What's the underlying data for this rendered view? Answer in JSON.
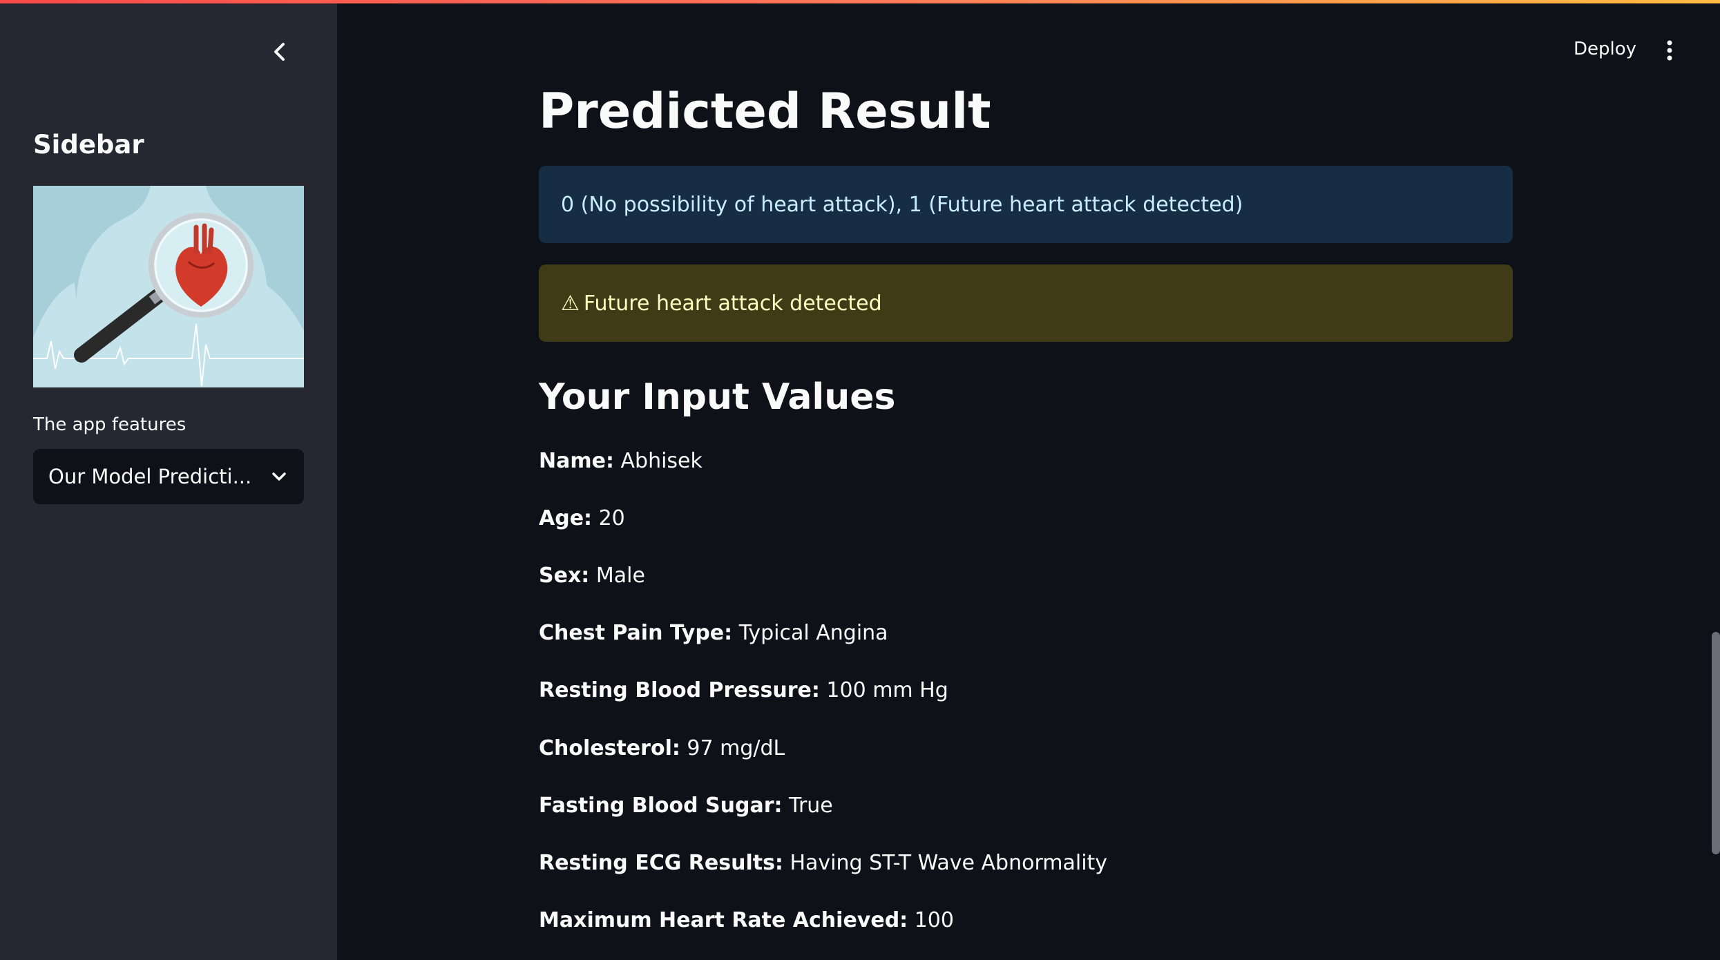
{
  "sidebar": {
    "title": "Sidebar",
    "features_label": "The app features",
    "select_value": "Our Model Predicti..."
  },
  "header": {
    "deploy_label": "Deploy"
  },
  "main": {
    "title": "Predicted Result",
    "info_text": "0 (No possibility of heart attack), 1 (Future heart attack detected)",
    "warning_text": "Future heart attack detected",
    "section_heading": "Your Input Values",
    "fields": [
      {
        "key": "Name:",
        "value": "Abhisek"
      },
      {
        "key": "Age:",
        "value": "20"
      },
      {
        "key": "Sex:",
        "value": "Male"
      },
      {
        "key": "Chest Pain Type:",
        "value": "Typical Angina"
      },
      {
        "key": "Resting Blood Pressure:",
        "value": "100 mm Hg"
      },
      {
        "key": "Cholesterol:",
        "value": "97 mg/dL"
      },
      {
        "key": "Fasting Blood Sugar:",
        "value": "True"
      },
      {
        "key": "Resting ECG Results:",
        "value": "Having ST-T Wave Abnormality"
      },
      {
        "key": "Maximum Heart Rate Achieved:",
        "value": "100"
      }
    ]
  },
  "icons": {
    "collapse": "chevron-left-icon",
    "dropdown": "chevron-down-icon",
    "menu": "kebab-menu-icon",
    "warning": "warning-triangle-icon"
  },
  "colors": {
    "accent_gradient_start": "#ff4b4b",
    "accent_gradient_end": "#ffbd45",
    "info_bg": "#172d43",
    "warning_bg": "#3e3b16"
  }
}
